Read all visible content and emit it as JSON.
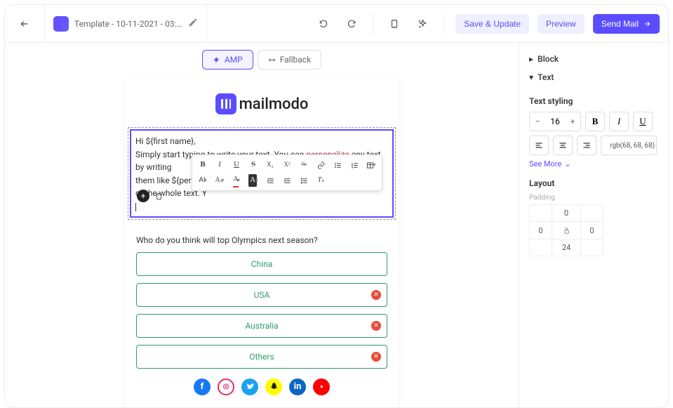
{
  "header": {
    "title": "Template - 10-11-2021 - 03:…",
    "save_label": "Save & Update",
    "preview_label": "Preview",
    "send_label": "Send Mail"
  },
  "tabs": {
    "amp": "AMP",
    "fallback": "Fallback"
  },
  "brand": {
    "name": "mailmodo"
  },
  "text_block": {
    "line1": "Hi ${first name},",
    "line2a": "Simply start typing to write your text. You can ",
    "line2b": "personalize",
    "line2c": " any text by writing",
    "line3": "them like ${person",
    "line4": "or the whole text. Y"
  },
  "question": "Who do you think will top Olympics next season?",
  "options": [
    "China",
    "USA",
    "Australia",
    "Others"
  ],
  "sidebar": {
    "block": "Block",
    "text": "Text",
    "text_styling": "Text styling",
    "font_size": "16",
    "color_value": "rgb(68, 68, 68)",
    "see_more": "See More",
    "layout": "Layout",
    "padding_label": "Padding",
    "padding": {
      "top": "0",
      "right": "0",
      "bottom": "24",
      "left": "0"
    }
  }
}
